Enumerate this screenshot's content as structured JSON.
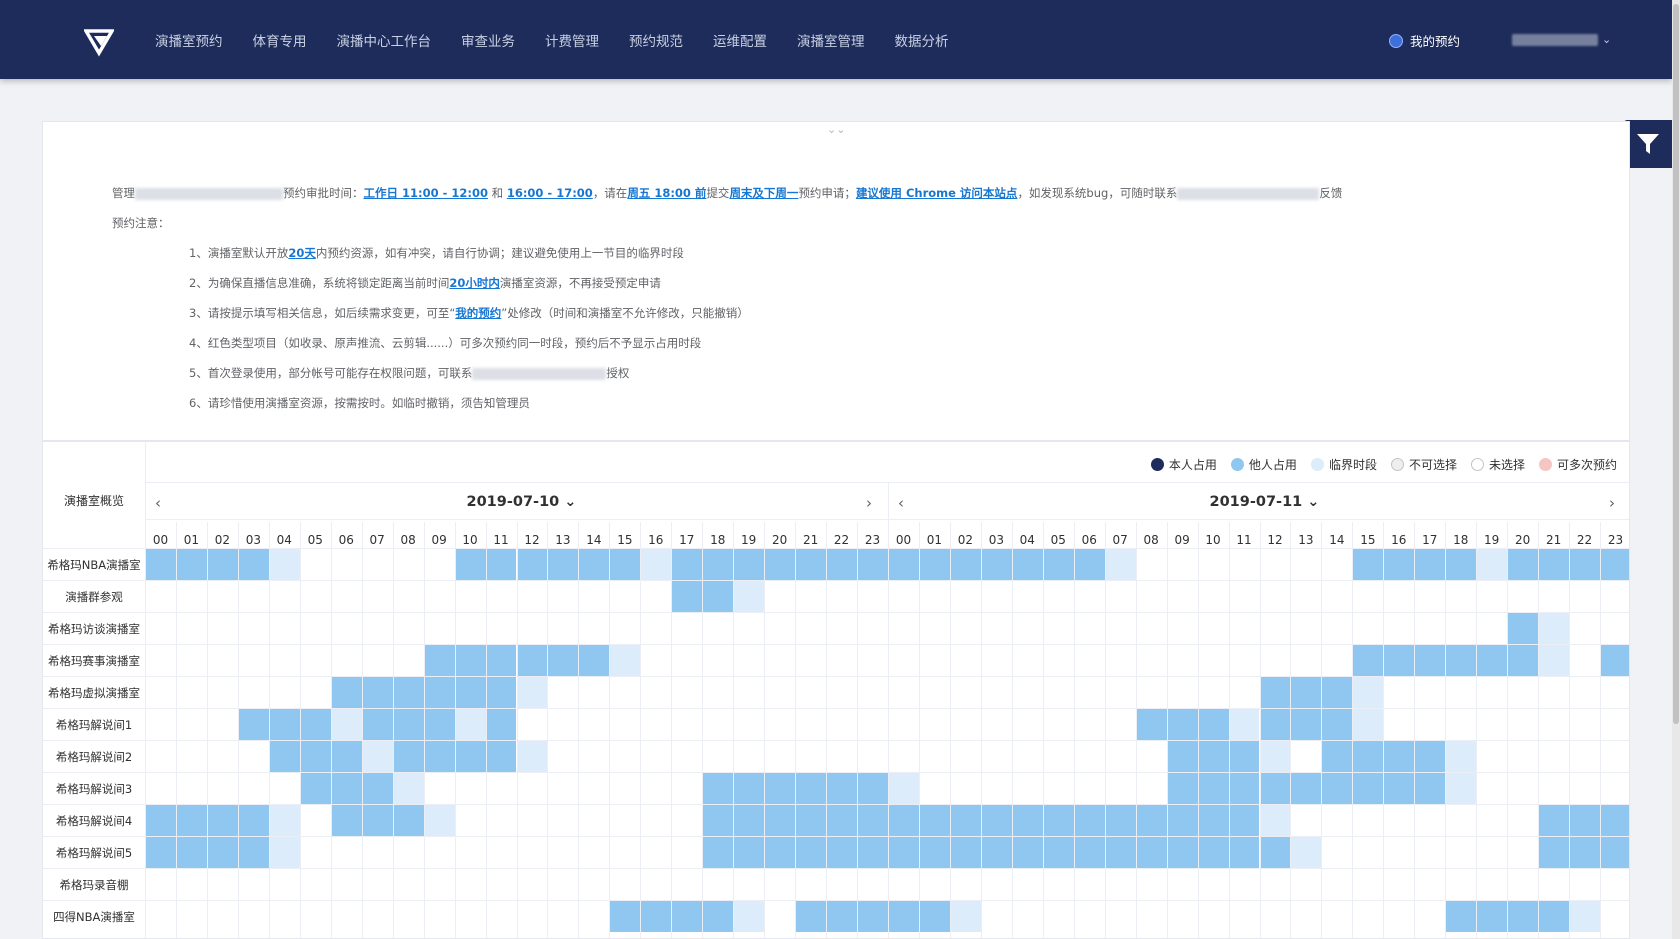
{
  "header": {
    "nav": [
      "演播室预约",
      "体育专用",
      "演播中心工作台",
      "审查业务",
      "计费管理",
      "预约规范",
      "运维配置",
      "演播室管理",
      "数据分析"
    ],
    "my_reservation": "我的预约",
    "logo_icon": "v-logo-icon",
    "user_caret": "⌄"
  },
  "notice": {
    "collapse_icon": "⌄⌄",
    "line1": {
      "p1": "管理",
      "p2": "预约审批时间：",
      "l1": "工作日 11:00 - 12:00",
      "p3": " 和 ",
      "l2": "16:00 - 17:00",
      "p4": "，请在",
      "l3": "周五 18:00 前",
      "p5": "提交",
      "l4": "周末及下周一",
      "p6": "预约申请；",
      "l5": "建议使用 Chrome 访问本站点",
      "p7": "，如发现系统bug，可随时联系",
      "p8": "反馈"
    },
    "subtitle": "预约注意：",
    "items": [
      {
        "a": "1、演播室默认开放",
        "l": "20天",
        "b": "内预约资源，如有冲突，请自行协调；建议避免使用上一节目的临界时段"
      },
      {
        "a": "2、为确保直播信息准确，系统将锁定距离当前时间",
        "l": "20小时内",
        "b": "演播室资源，不再接受预定申请"
      },
      {
        "a": "3、请按提示填写相关信息，如后续需求变更，可至“",
        "l": "我的预约",
        "b": "”处修改（时间和演播室不允许修改，只能撤销）"
      },
      {
        "a": "4、红色类型项目（如收录、原声推流、云剪辑......）可多次预约同一时段，预约后不予显示占用时段",
        "l": "",
        "b": ""
      },
      {
        "a": "5、首次登录使用，部分帐号可能存在权限问题，可联系",
        "l": "",
        "b": "授权"
      },
      {
        "a": "6、请珍惜使用演播室资源，按需按时。如临时撤销，须告知管理员",
        "l": "",
        "b": ""
      }
    ]
  },
  "legend": [
    {
      "label": "本人占用",
      "color": "#1e2c5b"
    },
    {
      "label": "他人占用",
      "color": "#90c7f0"
    },
    {
      "label": "临界时段",
      "color": "#ddecfa"
    },
    {
      "label": "不可选择",
      "color": "#eeeeee"
    },
    {
      "label": "未选择",
      "color": "#ffffff"
    },
    {
      "label": "可多次预约",
      "color": "#f7c4c4"
    }
  ],
  "schedule": {
    "overview_label": "演播室概览",
    "days": [
      {
        "date": "2019-07-10",
        "prev": "‹",
        "next": "›",
        "caret": "⌄"
      },
      {
        "date": "2019-07-11",
        "prev": "‹",
        "next": "›",
        "caret": "⌄"
      }
    ],
    "hours": [
      "00",
      "01",
      "02",
      "03",
      "04",
      "05",
      "06",
      "07",
      "08",
      "09",
      "10",
      "11",
      "12",
      "13",
      "14",
      "15",
      "16",
      "17",
      "18",
      "19",
      "20",
      "21",
      "22",
      "23"
    ],
    "rooms": [
      {
        "name": "希格玛NBA演播室",
        "s": "111120000011111121111111111111120000000111121111111"
      },
      {
        "name": "演播群参观",
        "s": "000000000000000001120000000000000000000000000000000"
      },
      {
        "name": "希格玛访谈演播室",
        "s": "000000000000000000000000000000000000000000001200000000"
      },
      {
        "name": "希格玛赛事演播室",
        "s": "000000000111111200000000000000000000000111111201112000000"
      },
      {
        "name": "希格玛虚拟演播室",
        "s": "000000111111200000000000000000000000111200000000111111"
      },
      {
        "name": "希格玛解说间1",
        "s": "000111211121000000000000000000001112111200000000000000"
      },
      {
        "name": "希格玛解说间2",
        "s": "000011121111200000000000000000000111201111200000000000"
      },
      {
        "name": "希格玛解说间3",
        "s": "000001112000000000111111200000000111111111200000000000"
      },
      {
        "name": "希格玛解说间4",
        "s": "111120111200000000111111111111111111200000000111111111"
      },
      {
        "name": "希格玛解说间5",
        "s": "111120000000000000111111111111111111120000000111111111"
      },
      {
        "name": "希格玛录音棚",
        "s": "000000000000000000000000000000000000000000000000000000"
      },
      {
        "name": "四得NBA演播室",
        "s": "000000000000000111120111112000000000000000111120000000000"
      }
    ]
  }
}
